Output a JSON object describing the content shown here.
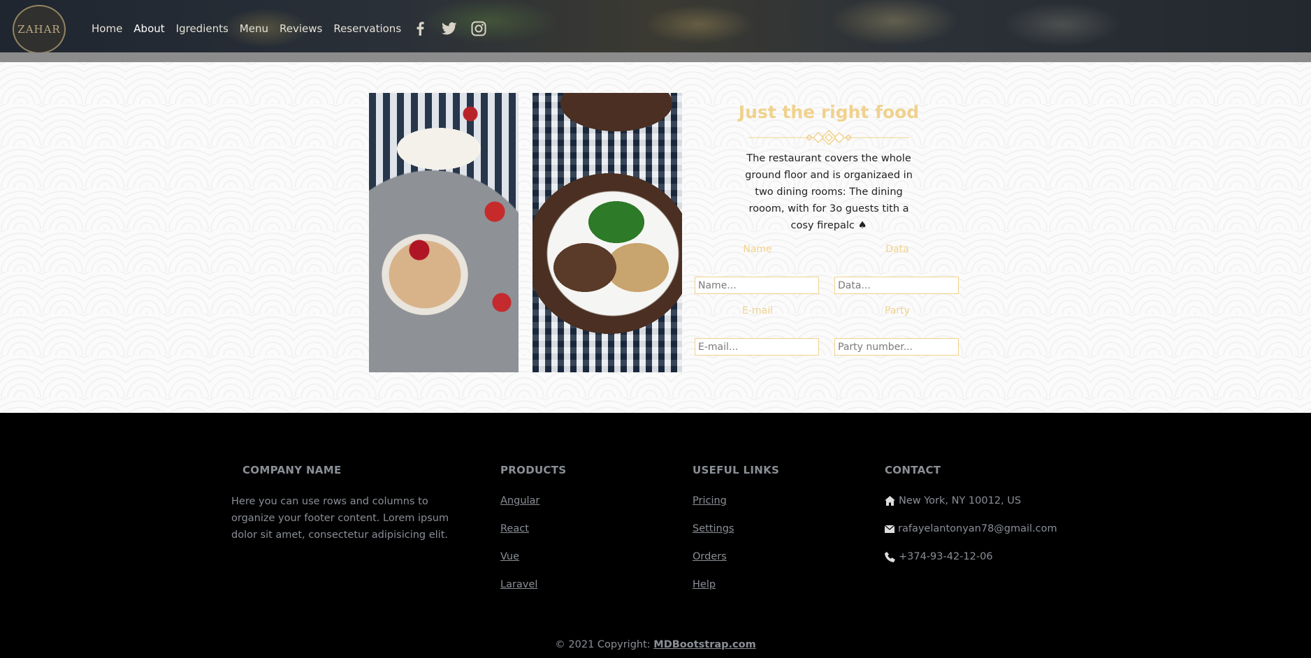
{
  "header": {
    "logo_text": "ZAHAR",
    "nav": [
      {
        "label": "Home"
      },
      {
        "label": "About"
      },
      {
        "label": "Igredients"
      },
      {
        "label": "Menu"
      },
      {
        "label": "Reviews"
      },
      {
        "label": "Reservations"
      }
    ],
    "social_icons": [
      "facebook-icon",
      "twitter-icon",
      "instagram-icon"
    ]
  },
  "about": {
    "title": "Just the right food",
    "description": "The restaurant covers the whole ground floor and is organizaed in two dining rooms: The dining rooom, with for 3o guests tith a cosy firepalc ♠",
    "form": {
      "name_label": "Name",
      "name_placeholder": "Name...",
      "data_label": "Data",
      "data_placeholder": "Data...",
      "email_label": "E-mail",
      "email_placeholder": "E-mail...",
      "party_label": "Party",
      "party_placeholder": "Party number..."
    }
  },
  "footer": {
    "company": {
      "title": "COMPANY NAME",
      "text": "Here you can use rows and columns to organize your footer content. Lorem ipsum dolor sit amet, consectetur adipisicing elit."
    },
    "products": {
      "title": "PRODUCTS",
      "links": [
        {
          "label": "Angular"
        },
        {
          "label": "React"
        },
        {
          "label": "Vue"
        },
        {
          "label": "Laravel"
        }
      ]
    },
    "useful_links": {
      "title": "USEFUL LINKS",
      "links": [
        {
          "label": "Pricing"
        },
        {
          "label": "Settings"
        },
        {
          "label": "Orders"
        },
        {
          "label": "Help"
        }
      ]
    },
    "contact": {
      "title": "CONTACT",
      "address": "New York, NY 10012, US",
      "email": "rafayelantonyan78@gmail.com",
      "phone": "+374-93-42-12-06"
    },
    "copyright_prefix": "© 2021 Copyright:",
    "copyright_link": "MDBootstrap.com"
  },
  "colors": {
    "accent_gold": "#f0d28e",
    "footer_bg": "#000000",
    "footer_text": "#8a8f96"
  }
}
